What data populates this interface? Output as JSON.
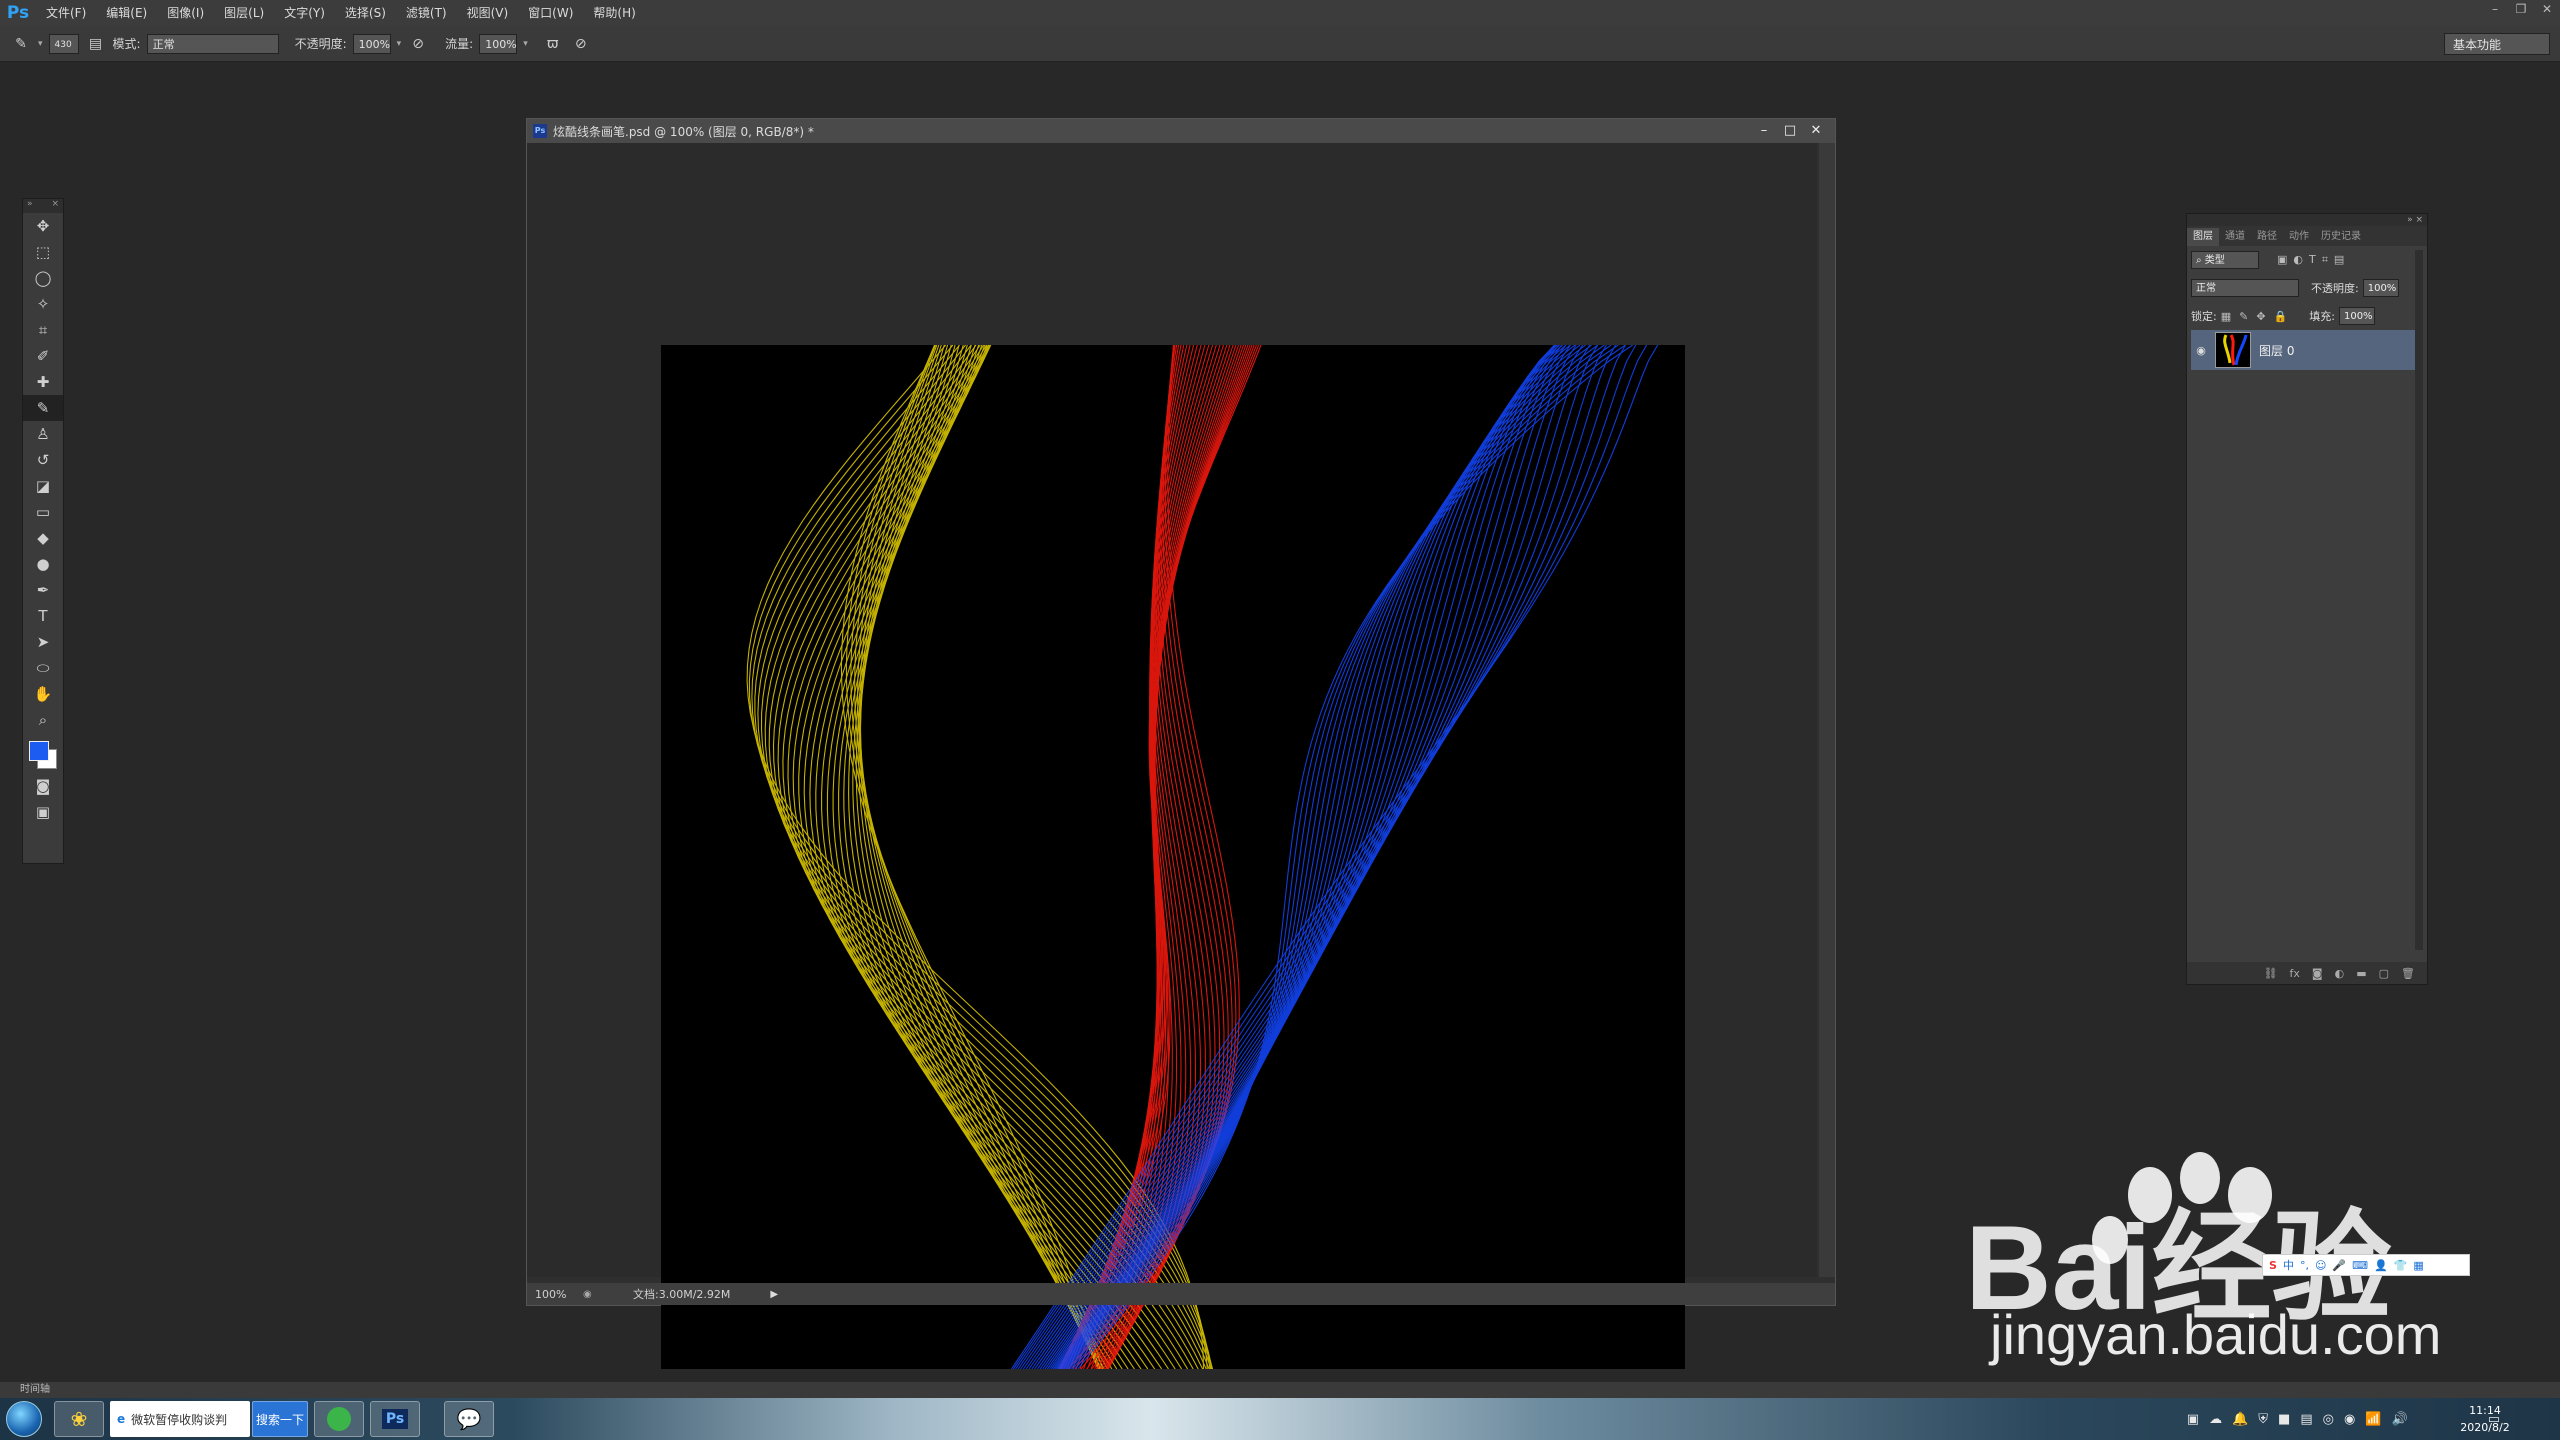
{
  "app": {
    "logo": "Ps"
  },
  "menu": [
    "文件(F)",
    "编辑(E)",
    "图像(I)",
    "图层(L)",
    "文字(Y)",
    "选择(S)",
    "滤镜(T)",
    "视图(V)",
    "窗口(W)",
    "帮助(H)"
  ],
  "options": {
    "brush_size": "430",
    "mode_label": "模式:",
    "mode_value": "正常",
    "opacity_label": "不透明度:",
    "opacity_value": "100%",
    "flow_label": "流量:",
    "flow_value": "100%",
    "workspace": "基本功能"
  },
  "document": {
    "title": "炫酷线条画笔.psd @ 100% (图层 0, RGB/8*) *",
    "zoom": "100%",
    "doc_size": "文档:3.00M/2.92M"
  },
  "layers_panel": {
    "tabs": [
      "图层",
      "通道",
      "路径",
      "动作",
      "历史记录"
    ],
    "filter_kind": "类型",
    "blend_mode": "正常",
    "opacity_label": "不透明度:",
    "opacity_value": "100%",
    "lock_label": "锁定:",
    "fill_label": "填充:",
    "fill_value": "100%",
    "layer_name": "图层 0"
  },
  "timeline": {
    "label": "时间轴"
  },
  "watermark": {
    "brand": "Bai经验",
    "url": "jingyan.baidu.com"
  },
  "taskbar": {
    "ie_tab": "微软暂停收购谈判",
    "search_button": "搜索一下",
    "time": "11:14",
    "date": "2020/8/2"
  },
  "colors": {
    "foreground": "#1c5cf0",
    "background": "#ffffff",
    "ribbon_yellow": "#e8d200",
    "ribbon_red": "#ff1a10",
    "ribbon_blue": "#1448ff"
  }
}
